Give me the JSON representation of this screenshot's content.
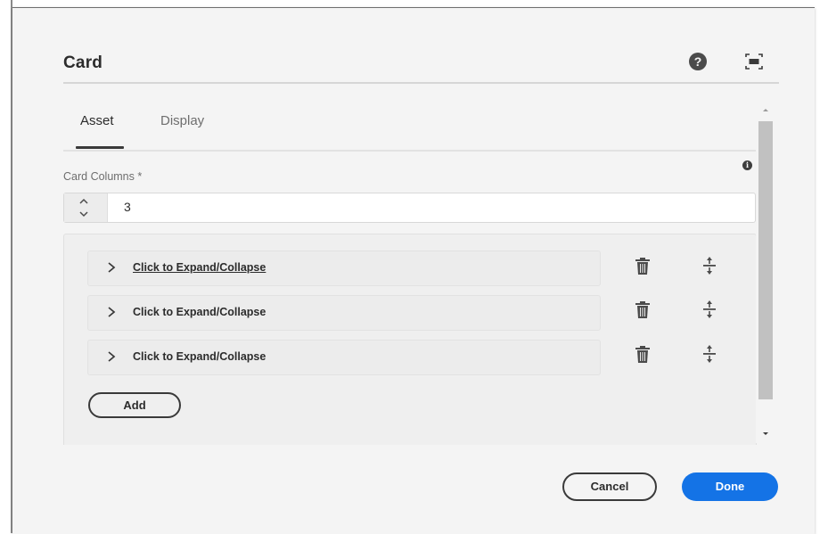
{
  "dialog": {
    "title": "Card",
    "help_icon": "help-icon",
    "fullscreen_icon": "fullscreen-icon"
  },
  "tabs": [
    {
      "label": "Asset",
      "active": true
    },
    {
      "label": "Display",
      "active": false
    }
  ],
  "card_columns": {
    "label": "Card Columns *",
    "value": "3",
    "info_icon": "info-icon"
  },
  "multifield": {
    "items": [
      {
        "label": "Click to Expand/Collapse",
        "underlined": true
      },
      {
        "label": "Click to Expand/Collapse",
        "underlined": false
      },
      {
        "label": "Click to Expand/Collapse",
        "underlined": false
      }
    ],
    "add_label": "Add"
  },
  "footer": {
    "cancel_label": "Cancel",
    "done_label": "Done"
  },
  "colors": {
    "primary": "#1473e6",
    "dialog_bg": "#f4f4f4",
    "text": "#2c2c2c"
  }
}
